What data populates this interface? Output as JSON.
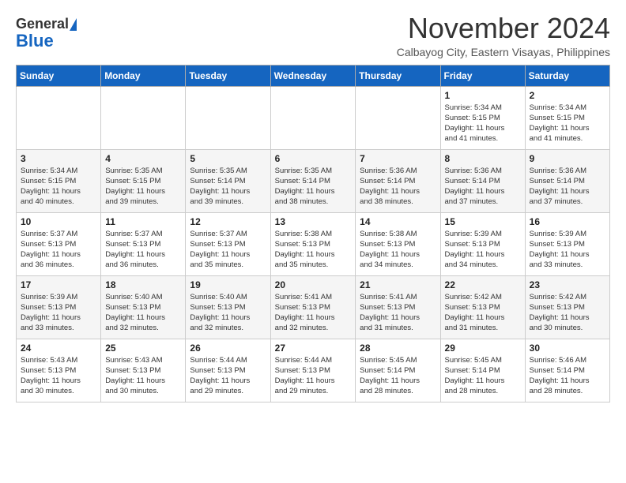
{
  "header": {
    "logo_general": "General",
    "logo_blue": "Blue",
    "month": "November 2024",
    "location": "Calbayog City, Eastern Visayas, Philippines"
  },
  "weekdays": [
    "Sunday",
    "Monday",
    "Tuesday",
    "Wednesday",
    "Thursday",
    "Friday",
    "Saturday"
  ],
  "weeks": [
    [
      {
        "day": "",
        "info": ""
      },
      {
        "day": "",
        "info": ""
      },
      {
        "day": "",
        "info": ""
      },
      {
        "day": "",
        "info": ""
      },
      {
        "day": "",
        "info": ""
      },
      {
        "day": "1",
        "info": "Sunrise: 5:34 AM\nSunset: 5:15 PM\nDaylight: 11 hours\nand 41 minutes."
      },
      {
        "day": "2",
        "info": "Sunrise: 5:34 AM\nSunset: 5:15 PM\nDaylight: 11 hours\nand 41 minutes."
      }
    ],
    [
      {
        "day": "3",
        "info": "Sunrise: 5:34 AM\nSunset: 5:15 PM\nDaylight: 11 hours\nand 40 minutes."
      },
      {
        "day": "4",
        "info": "Sunrise: 5:35 AM\nSunset: 5:15 PM\nDaylight: 11 hours\nand 39 minutes."
      },
      {
        "day": "5",
        "info": "Sunrise: 5:35 AM\nSunset: 5:14 PM\nDaylight: 11 hours\nand 39 minutes."
      },
      {
        "day": "6",
        "info": "Sunrise: 5:35 AM\nSunset: 5:14 PM\nDaylight: 11 hours\nand 38 minutes."
      },
      {
        "day": "7",
        "info": "Sunrise: 5:36 AM\nSunset: 5:14 PM\nDaylight: 11 hours\nand 38 minutes."
      },
      {
        "day": "8",
        "info": "Sunrise: 5:36 AM\nSunset: 5:14 PM\nDaylight: 11 hours\nand 37 minutes."
      },
      {
        "day": "9",
        "info": "Sunrise: 5:36 AM\nSunset: 5:14 PM\nDaylight: 11 hours\nand 37 minutes."
      }
    ],
    [
      {
        "day": "10",
        "info": "Sunrise: 5:37 AM\nSunset: 5:13 PM\nDaylight: 11 hours\nand 36 minutes."
      },
      {
        "day": "11",
        "info": "Sunrise: 5:37 AM\nSunset: 5:13 PM\nDaylight: 11 hours\nand 36 minutes."
      },
      {
        "day": "12",
        "info": "Sunrise: 5:37 AM\nSunset: 5:13 PM\nDaylight: 11 hours\nand 35 minutes."
      },
      {
        "day": "13",
        "info": "Sunrise: 5:38 AM\nSunset: 5:13 PM\nDaylight: 11 hours\nand 35 minutes."
      },
      {
        "day": "14",
        "info": "Sunrise: 5:38 AM\nSunset: 5:13 PM\nDaylight: 11 hours\nand 34 minutes."
      },
      {
        "day": "15",
        "info": "Sunrise: 5:39 AM\nSunset: 5:13 PM\nDaylight: 11 hours\nand 34 minutes."
      },
      {
        "day": "16",
        "info": "Sunrise: 5:39 AM\nSunset: 5:13 PM\nDaylight: 11 hours\nand 33 minutes."
      }
    ],
    [
      {
        "day": "17",
        "info": "Sunrise: 5:39 AM\nSunset: 5:13 PM\nDaylight: 11 hours\nand 33 minutes."
      },
      {
        "day": "18",
        "info": "Sunrise: 5:40 AM\nSunset: 5:13 PM\nDaylight: 11 hours\nand 32 minutes."
      },
      {
        "day": "19",
        "info": "Sunrise: 5:40 AM\nSunset: 5:13 PM\nDaylight: 11 hours\nand 32 minutes."
      },
      {
        "day": "20",
        "info": "Sunrise: 5:41 AM\nSunset: 5:13 PM\nDaylight: 11 hours\nand 32 minutes."
      },
      {
        "day": "21",
        "info": "Sunrise: 5:41 AM\nSunset: 5:13 PM\nDaylight: 11 hours\nand 31 minutes."
      },
      {
        "day": "22",
        "info": "Sunrise: 5:42 AM\nSunset: 5:13 PM\nDaylight: 11 hours\nand 31 minutes."
      },
      {
        "day": "23",
        "info": "Sunrise: 5:42 AM\nSunset: 5:13 PM\nDaylight: 11 hours\nand 30 minutes."
      }
    ],
    [
      {
        "day": "24",
        "info": "Sunrise: 5:43 AM\nSunset: 5:13 PM\nDaylight: 11 hours\nand 30 minutes."
      },
      {
        "day": "25",
        "info": "Sunrise: 5:43 AM\nSunset: 5:13 PM\nDaylight: 11 hours\nand 30 minutes."
      },
      {
        "day": "26",
        "info": "Sunrise: 5:44 AM\nSunset: 5:13 PM\nDaylight: 11 hours\nand 29 minutes."
      },
      {
        "day": "27",
        "info": "Sunrise: 5:44 AM\nSunset: 5:13 PM\nDaylight: 11 hours\nand 29 minutes."
      },
      {
        "day": "28",
        "info": "Sunrise: 5:45 AM\nSunset: 5:14 PM\nDaylight: 11 hours\nand 28 minutes."
      },
      {
        "day": "29",
        "info": "Sunrise: 5:45 AM\nSunset: 5:14 PM\nDaylight: 11 hours\nand 28 minutes."
      },
      {
        "day": "30",
        "info": "Sunrise: 5:46 AM\nSunset: 5:14 PM\nDaylight: 11 hours\nand 28 minutes."
      }
    ]
  ]
}
